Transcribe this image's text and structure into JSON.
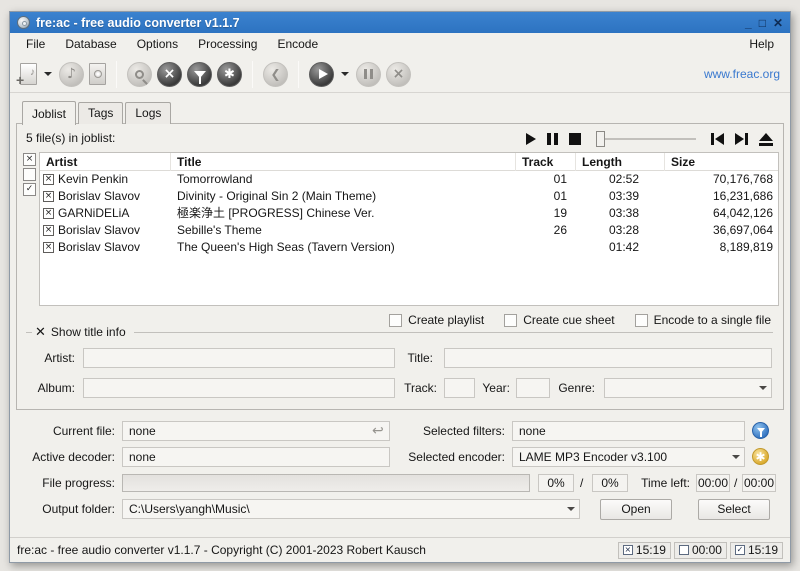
{
  "window": {
    "title": "fre:ac - free audio converter v1.1.7",
    "controls": {
      "minimize": "_",
      "maximize": "□",
      "close": "✕"
    }
  },
  "menu": {
    "items": [
      "File",
      "Database",
      "Options",
      "Processing",
      "Encode"
    ],
    "help": "Help"
  },
  "toolbar": {
    "link": "www.freac.org"
  },
  "tabs": [
    "Joblist",
    "Tags",
    "Logs"
  ],
  "joblist": {
    "count_label": "5 file(s) in joblist:",
    "columns": [
      "Artist",
      "Title",
      "Track",
      "Length",
      "Size"
    ],
    "rows": [
      {
        "artist": "Kevin Penkin",
        "title": "Tomorrowland",
        "track": "01",
        "length": "02:52",
        "size": "70,176,768"
      },
      {
        "artist": "Borislav Slavov",
        "title": "Divinity - Original Sin 2 (Main Theme)",
        "track": "01",
        "length": "03:39",
        "size": "16,231,686"
      },
      {
        "artist": "GARNiDELiA",
        "title": "極楽浄土 [PROGRESS] Chinese Ver.",
        "track": "19",
        "length": "03:38",
        "size": "64,042,126"
      },
      {
        "artist": "Borislav Slavov",
        "title": "Sebille's Theme",
        "track": "26",
        "length": "03:28",
        "size": "36,697,064"
      },
      {
        "artist": "Borislav Slavov",
        "title": "The Queen's High Seas (Tavern Version)",
        "track": "",
        "length": "01:42",
        "size": "8,189,819"
      }
    ]
  },
  "options": {
    "create_playlist": "Create playlist",
    "create_cue_sheet": "Create cue sheet",
    "encode_single": "Encode to a single file"
  },
  "title_info": {
    "header": "Show title info",
    "artist_label": "Artist:",
    "album_label": "Album:",
    "title_label": "Title:",
    "track_label": "Track:",
    "year_label": "Year:",
    "genre_label": "Genre:",
    "artist_value": "",
    "album_value": "",
    "title_value": "",
    "track_value": "",
    "year_value": "",
    "genre_value": ""
  },
  "status_panel": {
    "current_file_label": "Current file:",
    "current_file": "none",
    "active_decoder_label": "Active decoder:",
    "active_decoder": "none",
    "selected_filters_label": "Selected filters:",
    "selected_filters": "none",
    "selected_encoder_label": "Selected encoder:",
    "selected_encoder": "LAME MP3 Encoder v3.100",
    "file_progress_label": "File progress:",
    "progress_pct": "0%",
    "total_pct": "0%",
    "slash": "/",
    "time_left_label": "Time left:",
    "time_left": "00:00",
    "time_total": "00:00",
    "output_folder_label": "Output folder:",
    "output_folder": "C:\\Users\\yangh\\Music\\",
    "open_button": "Open",
    "select_button": "Select"
  },
  "statusbar": {
    "text": "fre:ac - free audio converter v1.1.7 - Copyright (C) 2001-2023 Robert Kausch",
    "time1": "15:19",
    "time2": "00:00",
    "time3": "15:19"
  }
}
